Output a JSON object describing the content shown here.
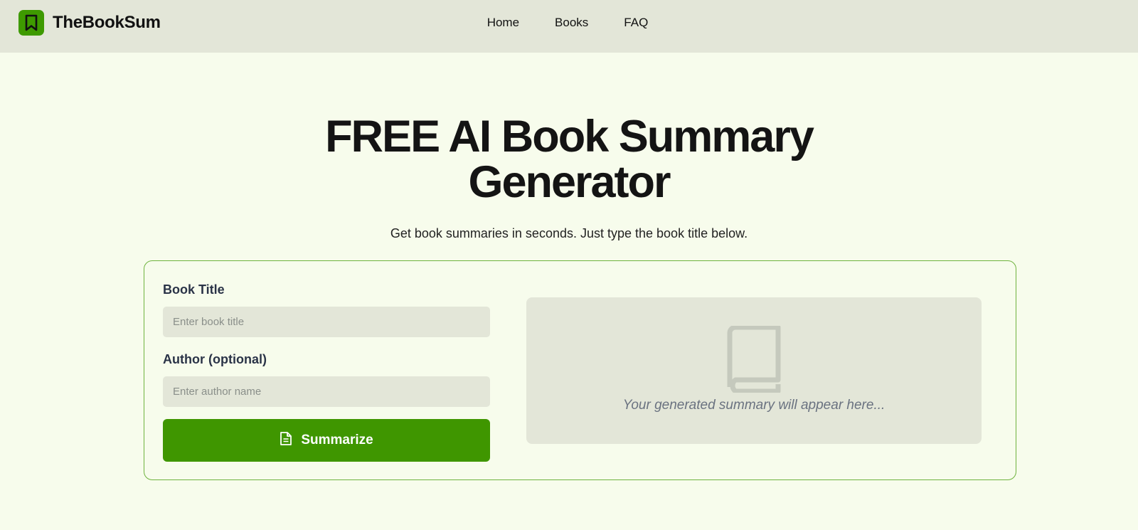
{
  "header": {
    "brand_name": "TheBookSum",
    "nav": [
      {
        "label": "Home"
      },
      {
        "label": "Books"
      },
      {
        "label": "FAQ"
      }
    ]
  },
  "hero": {
    "title_line1": "FREE AI Book Summary",
    "title_line2": "Generator",
    "subtitle": "Get book summaries in seconds. Just type the book title below."
  },
  "form": {
    "title_label": "Book Title",
    "title_placeholder": "Enter book title",
    "title_value": "",
    "author_label": "Author (optional)",
    "author_placeholder": "Enter author name",
    "author_value": "",
    "submit_label": "Summarize"
  },
  "output": {
    "placeholder": "Your generated summary will appear here..."
  },
  "icons": {
    "brand": "bookmark-icon",
    "submit": "document-icon",
    "output": "book-icon"
  },
  "colors": {
    "accent": "#3f9600",
    "background": "#f7fcec",
    "header_bg": "#e3e6d8",
    "card_border": "#6fb33e"
  }
}
